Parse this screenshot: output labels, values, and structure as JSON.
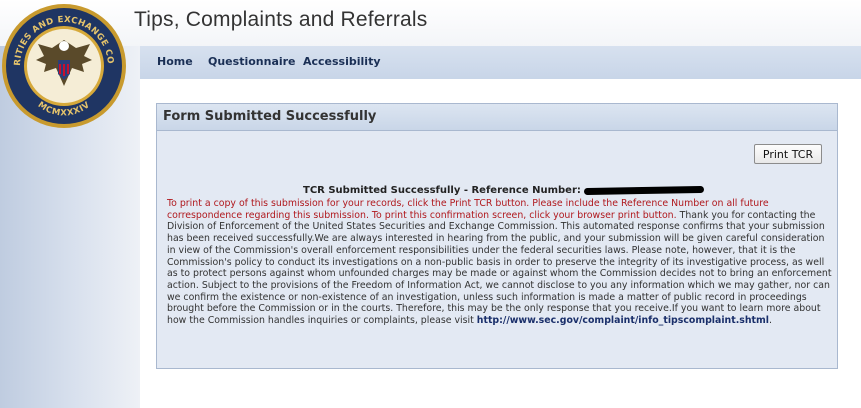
{
  "app": {
    "title": "Tips, Complaints and Referrals"
  },
  "nav": [
    {
      "label": "Home"
    },
    {
      "label": "Questionnaire"
    },
    {
      "label": "Accessibility"
    }
  ],
  "seal": {
    "text_top": "U.S. SECURITIES AND EXCHANGE COMMISSION",
    "year": "MCMXXXIV"
  },
  "panel": {
    "title": "Form Submitted Successfully",
    "print_button": "Print TCR",
    "reference_label": "TCR Submitted Successfully - Reference Number:",
    "red_text": "To print a copy of this submission for your records, click the Print TCR button. Please include the Reference Number on all future correspondence regarding this submission. To print this confirmation screen, click your browser print button.",
    "body_text": " Thank you for contacting the Division of Enforcement of the United States Securities and Exchange Commission. This automated response confirms that your submission has been received successfully.We are always interested in hearing from the public, and your submission will be given careful consideration in view of the Commission's overall enforcement responsibilities under the federal securities laws. Please note, however, that it is the Commission's policy to conduct its investigations on a non-public basis in order to preserve the integrity of its investigative process, as well as to protect persons against whom unfounded charges may be made or against whom the Commission decides not to bring an enforcement action. Subject to the provisions of the Freedom of Information Act, we cannot disclose to you any information which we may gather, nor can we confirm the existence or non-existence of an investigation, unless such information is made a matter of public record in proceedings brought before the Commission or in the courts. Therefore, this may be the only response that you receive.If you want to learn more about how the Commission handles inquiries or complaints, please visit ",
    "link_text": "http://www.sec.gov/complaint/info_tipscomplaint.shtml",
    "link_suffix": "."
  },
  "colors": {
    "nav_text": "#1a2f55",
    "red_text": "#b0191e",
    "panel_bg": "#e3e9f3"
  }
}
